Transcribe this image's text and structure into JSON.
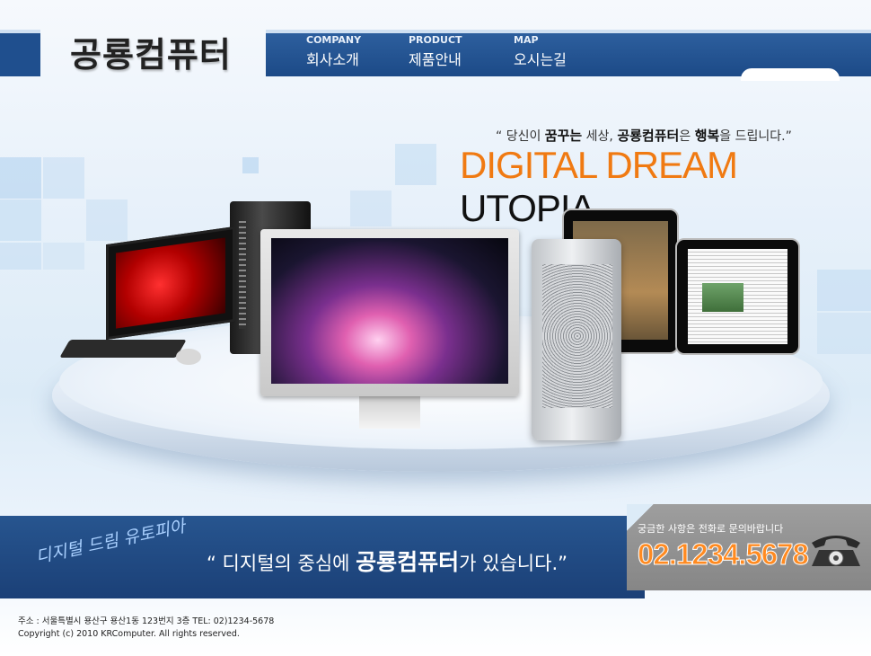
{
  "brand": {
    "logo": "공룡컴퓨터"
  },
  "nav": {
    "items": [
      {
        "en": "COMPANY",
        "ko": "회사소개"
      },
      {
        "en": "PRODUCT",
        "ko": "제품안내"
      },
      {
        "en": "MAP",
        "ko": "오시는길"
      }
    ]
  },
  "hero": {
    "slogan_open": "“ 당신이 ",
    "slogan_b1": "꿈꾸는",
    "slogan_mid1": " 세상, ",
    "slogan_b2": "공룡컴퓨터",
    "slogan_mid2": "은 ",
    "slogan_b3": "행복",
    "slogan_end": "을 드립니다.”",
    "headline_orange": "DIGITAL DREAM",
    "headline_dark": " UTOPIA",
    "icons": [
      "red-monitor-icon",
      "black-tower-pc-icon",
      "keyboard-icon",
      "mouse-icon",
      "large-monitor-icon",
      "mac-pro-tower-icon",
      "tablet-icon",
      "tablet-newspaper-icon"
    ]
  },
  "banner": {
    "script": "디지털 드림 유토피아",
    "quote_open": "“ 디지털의 중심에 ",
    "quote_brand": "공룡컴퓨터",
    "quote_end": "가 있습니다.”"
  },
  "contact": {
    "label": "궁금한 사항은 전화로 문의바랍니다",
    "phone": "02.1234.5678",
    "icon": "telephone-icon"
  },
  "footer": {
    "address": "주소 : 서울특별시 용산구 용산1동 123번지 3층 TEL: 02)1234-5678",
    "copyright": "Copyright (c) 2010 KRComputer. All rights reserved."
  },
  "colors": {
    "nav_blue": "#1f4f8e",
    "accent_orange": "#f07a12",
    "banner_blue": "#1b4077",
    "phone_orange": "#ff8a20"
  }
}
